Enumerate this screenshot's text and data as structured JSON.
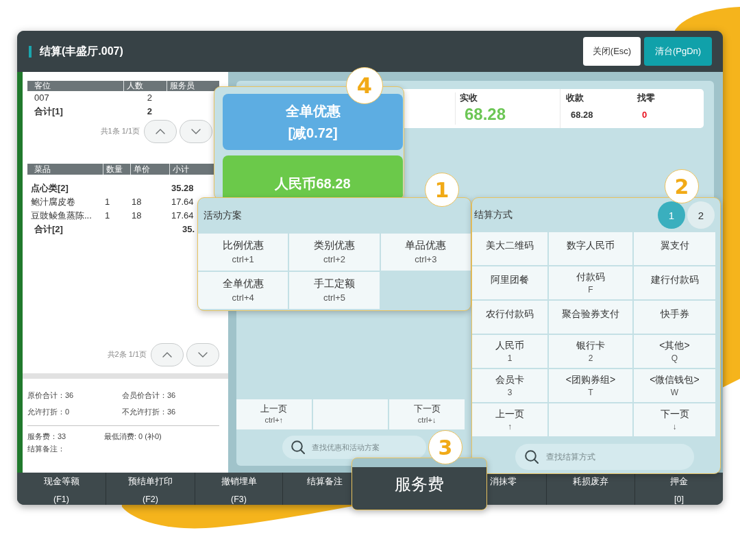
{
  "window": {
    "title": "结算(丰盛厅.007)",
    "buttons": [
      {
        "label": "关闭(Esc)",
        "kind": "secondary"
      },
      {
        "label": "清台(PgDn)",
        "kind": "primary"
      }
    ]
  },
  "guest_table": {
    "columns": [
      "客位",
      "人数",
      "服务员"
    ],
    "rows": [
      {
        "kind": "item",
        "seat": "007",
        "guests": "2"
      },
      {
        "kind": "total",
        "seat": "合计[1]",
        "guests": "2"
      }
    ],
    "pager": "共1条 1/1页"
  },
  "dish_table": {
    "columns": [
      "菜品",
      "数量",
      "单价",
      "小计"
    ],
    "rows": [
      {
        "kind": "group",
        "name": "点心类[2]",
        "subtotal": "35.28"
      },
      {
        "kind": "item",
        "name": "鲍汁腐皮卷",
        "quantity": "1",
        "price": "18",
        "subtotal": "17.64"
      },
      {
        "kind": "item",
        "name": "豆豉鲮鱼蒸陈...",
        "quantity": "1",
        "price": "18",
        "subtotal": "17.64"
      },
      {
        "kind": "total",
        "name": "合计[2]",
        "subtotal": "35."
      }
    ],
    "pager": "共2条 1/1页"
  },
  "bill_summary": {
    "rows": [
      [
        "原价合计：36",
        "会员价合计：36"
      ],
      [
        "允许打折：0",
        "不允许打折：36"
      ]
    ],
    "notes": [
      "服务费：33",
      "最低消费: 0 (补0)"
    ],
    "remark": "结算备注："
  },
  "payment_card": {
    "fields": [
      {
        "kind": "paid",
        "label": "实收",
        "value": "68.28"
      },
      {
        "kind": "received",
        "label": "收款",
        "value": "68.28"
      },
      {
        "kind": "change",
        "label": "找零",
        "value": "0"
      }
    ]
  },
  "activity_section": {
    "nav": [
      {
        "kind": "key",
        "label": "上一页",
        "shortcut": "ctrl+↑"
      },
      {
        "kind": "blank"
      },
      {
        "kind": "key",
        "label": "下一页",
        "shortcut": "ctrl+↓"
      }
    ],
    "search": {
      "placeholder": "查找优惠和活动方案"
    }
  },
  "callouts": [
    {
      "number": "4",
      "kind": "quick_actions",
      "buttons": [
        {
          "kind": "discount",
          "label": "全单优惠",
          "detail": "[减0.72]"
        },
        {
          "kind": "cash",
          "label": "人民币68.28"
        }
      ]
    },
    {
      "number": "1",
      "kind": "activity",
      "title": "活动方案",
      "options": [
        {
          "kind": "key",
          "label": "比例优惠",
          "shortcut": "ctrl+1"
        },
        {
          "kind": "key",
          "label": "类别优惠",
          "shortcut": "ctrl+2"
        },
        {
          "kind": "key",
          "label": "单品优惠",
          "shortcut": "ctrl+3"
        },
        {
          "kind": "key",
          "label": "全单优惠",
          "shortcut": "ctrl+4"
        },
        {
          "kind": "key",
          "label": "手工定额",
          "shortcut": "ctrl+5"
        }
      ]
    },
    {
      "number": "2",
      "kind": "payment",
      "title": "结算方式",
      "pages": [
        {
          "label": "1",
          "selected": true
        },
        {
          "label": "2",
          "selected": false
        }
      ],
      "options": [
        {
          "kind": "key",
          "label": "美大二维码"
        },
        {
          "kind": "key",
          "label": "数字人民币"
        },
        {
          "kind": "key",
          "label": "翼支付"
        },
        {
          "kind": "key",
          "label": "阿里团餐"
        },
        {
          "kind": "key",
          "label": "付款码",
          "shortcut": "F"
        },
        {
          "kind": "key",
          "label": "建行付款码"
        },
        {
          "kind": "key",
          "label": "农行付款码"
        },
        {
          "kind": "key",
          "label": "聚合验券支付"
        },
        {
          "kind": "key",
          "label": "快手券"
        },
        {
          "kind": "key",
          "label": "人民币",
          "shortcut": "1"
        },
        {
          "kind": "key",
          "label": "银行卡",
          "shortcut": "2"
        },
        {
          "kind": "key",
          "label": "<其他>",
          "shortcut": "Q"
        },
        {
          "kind": "key",
          "label": "会员卡",
          "shortcut": "3"
        },
        {
          "kind": "key",
          "label": "<团购券组>",
          "shortcut": "T"
        },
        {
          "kind": "key",
          "label": "<微信钱包>",
          "shortcut": "W"
        },
        {
          "kind": "key",
          "label": "上一页",
          "shortcut": "↑"
        },
        {
          "kind": "blank"
        },
        {
          "kind": "key",
          "label": "下一页",
          "shortcut": "↓"
        }
      ],
      "search": {
        "placeholder": "查找结算方式"
      }
    },
    {
      "number": "3",
      "kind": "service_fee",
      "label": "服务费"
    }
  ],
  "function_keys": [
    {
      "kind": "key",
      "label": "现金等额",
      "shortcut": "(F1)"
    },
    {
      "kind": "key",
      "label": "预结单打印",
      "shortcut": "(F2)"
    },
    {
      "kind": "key",
      "label": "撤销埋单",
      "shortcut": "(F3)"
    },
    {
      "kind": "key",
      "label": "结算备注"
    },
    {
      "kind": "covered"
    },
    {
      "kind": "key",
      "label": "消抹零"
    },
    {
      "kind": "key",
      "label": "耗损废弃"
    },
    {
      "kind": "key",
      "label": "押金",
      "shortcut": "[0]"
    }
  ]
}
